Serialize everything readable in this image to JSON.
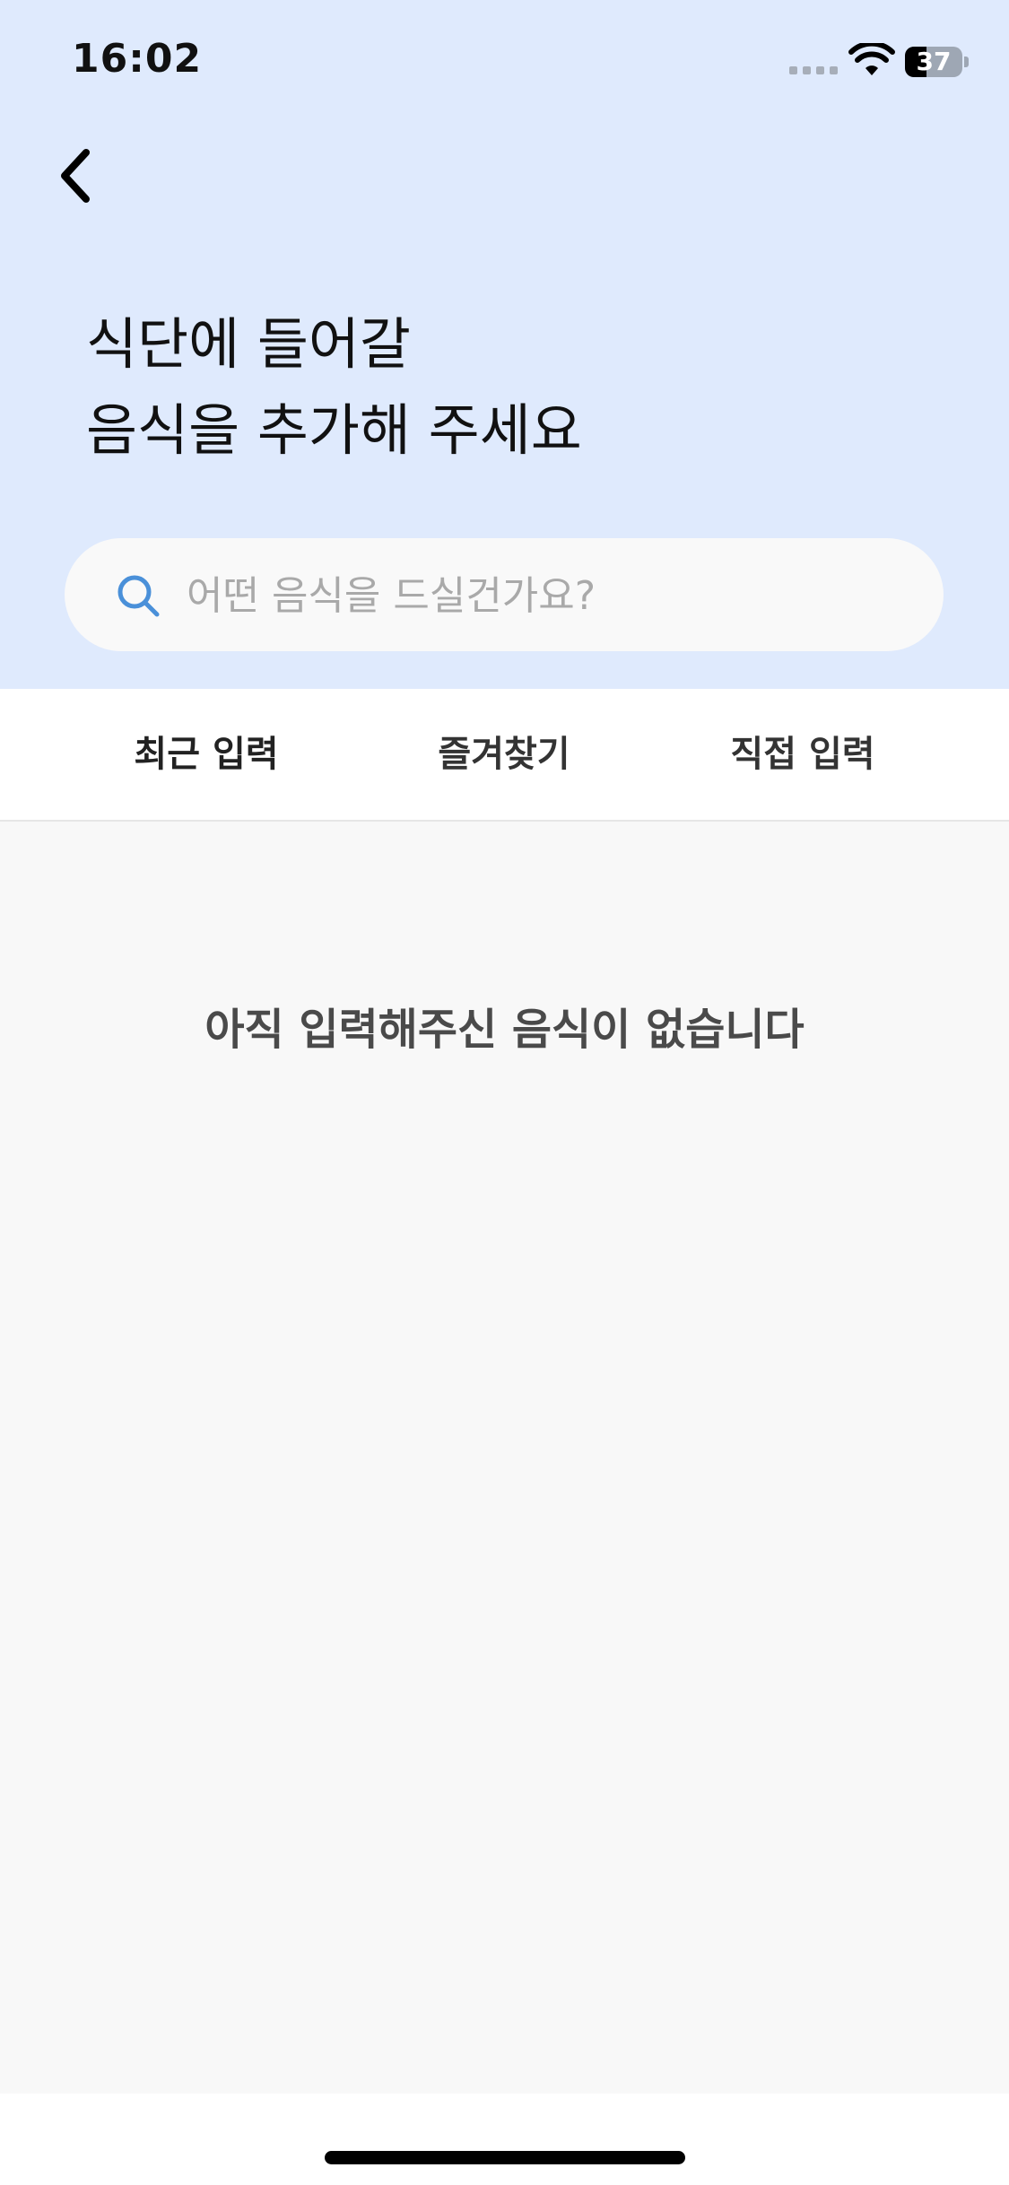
{
  "status_bar": {
    "time": "16:02",
    "battery_level": "37",
    "icons": [
      "signal-icon",
      "wifi-icon",
      "battery-icon"
    ]
  },
  "header": {
    "back_icon": "chevron-left-icon",
    "title_line1": "식단에 들어갈",
    "title_line2": "음식을 추가해 주세요",
    "background_color": "#dfeafd"
  },
  "search": {
    "placeholder": "어떤 음식을 드실건가요?",
    "value": "",
    "icon": "search-icon",
    "icon_color": "#4a90d9"
  },
  "tabs": [
    {
      "label": "최근 입력"
    },
    {
      "label": "즐겨찾기"
    },
    {
      "label": "직접 입력"
    }
  ],
  "content": {
    "empty_message": "아직 입력해주신 음식이 없습니다"
  }
}
